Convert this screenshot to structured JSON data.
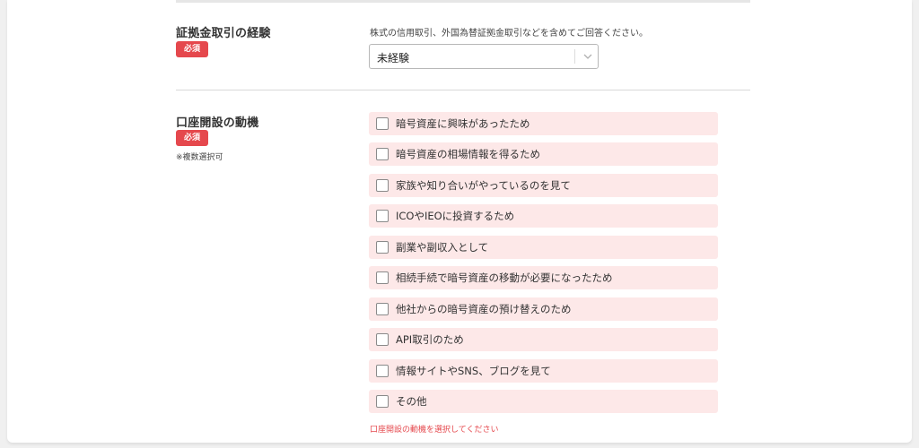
{
  "experience": {
    "title": "証拠金取引の経験",
    "required_badge": "必須",
    "description": "株式の信用取引、外国為替証拠金取引などを含めてご回答ください。",
    "select_value": "未経験"
  },
  "motivation": {
    "title": "口座開設の動機",
    "required_badge": "必須",
    "note": "※複数選択可",
    "options": [
      {
        "label": "暗号資産に興味があったため",
        "checked": false
      },
      {
        "label": "暗号資産の相場情報を得るため",
        "checked": false
      },
      {
        "label": "家族や知り合いがやっているのを見て",
        "checked": false
      },
      {
        "label": "ICOやIEOに投資するため",
        "checked": false
      },
      {
        "label": "副業や副収入として",
        "checked": false
      },
      {
        "label": "相続手続で暗号資産の移動が必要になったため",
        "checked": false
      },
      {
        "label": "他社からの暗号資産の預け替えのため",
        "checked": false
      },
      {
        "label": "API取引のため",
        "checked": false
      },
      {
        "label": "情報サイトやSNS、ブログを見て",
        "checked": false
      },
      {
        "label": "その他",
        "checked": false
      }
    ],
    "error_message": "口座開設の動機を選択してください"
  },
  "icons": {
    "select_arrow": "chevron-down-icon"
  },
  "colors": {
    "required_badge": "#e5484d",
    "option_background": "#fde8e8",
    "error_text": "#e5484d"
  }
}
